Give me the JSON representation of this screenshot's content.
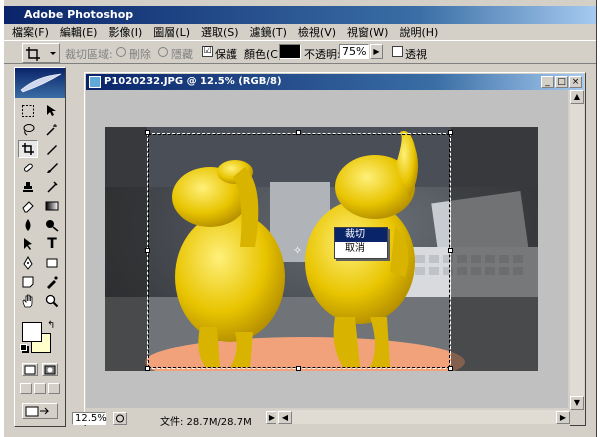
{
  "app": {
    "title": "Adobe Photoshop"
  },
  "menu": [
    "檔案(F)",
    "編輯(E)",
    "影像(I)",
    "圖層(L)",
    "選取(S)",
    "濾鏡(T)",
    "檢視(V)",
    "視窗(W)",
    "說明(H)"
  ],
  "options": {
    "crop_area_label": "裁切區域:",
    "delete_label": "刪除",
    "hide_label": "隱藏",
    "shield_label": "保護",
    "shield_checked": "☑",
    "color_label": "顏色(C):",
    "shield_color": "#000000",
    "opacity_label": "不透明:",
    "opacity_value": "75%",
    "perspective_label": "透視"
  },
  "document": {
    "title": "P1020232.JPG @ 12.5% (RGB/8)",
    "zoom": "12.5%",
    "doc_size": "文件: 28.7M/28.7M"
  },
  "context_menu": {
    "items": [
      "裁切",
      "取消"
    ],
    "selected_index": 0
  },
  "colors": {
    "accent": "#0a246a",
    "foreground_swatch": "#ffffff",
    "background_swatch": "#ffffcc",
    "figure": "#e8c400"
  }
}
